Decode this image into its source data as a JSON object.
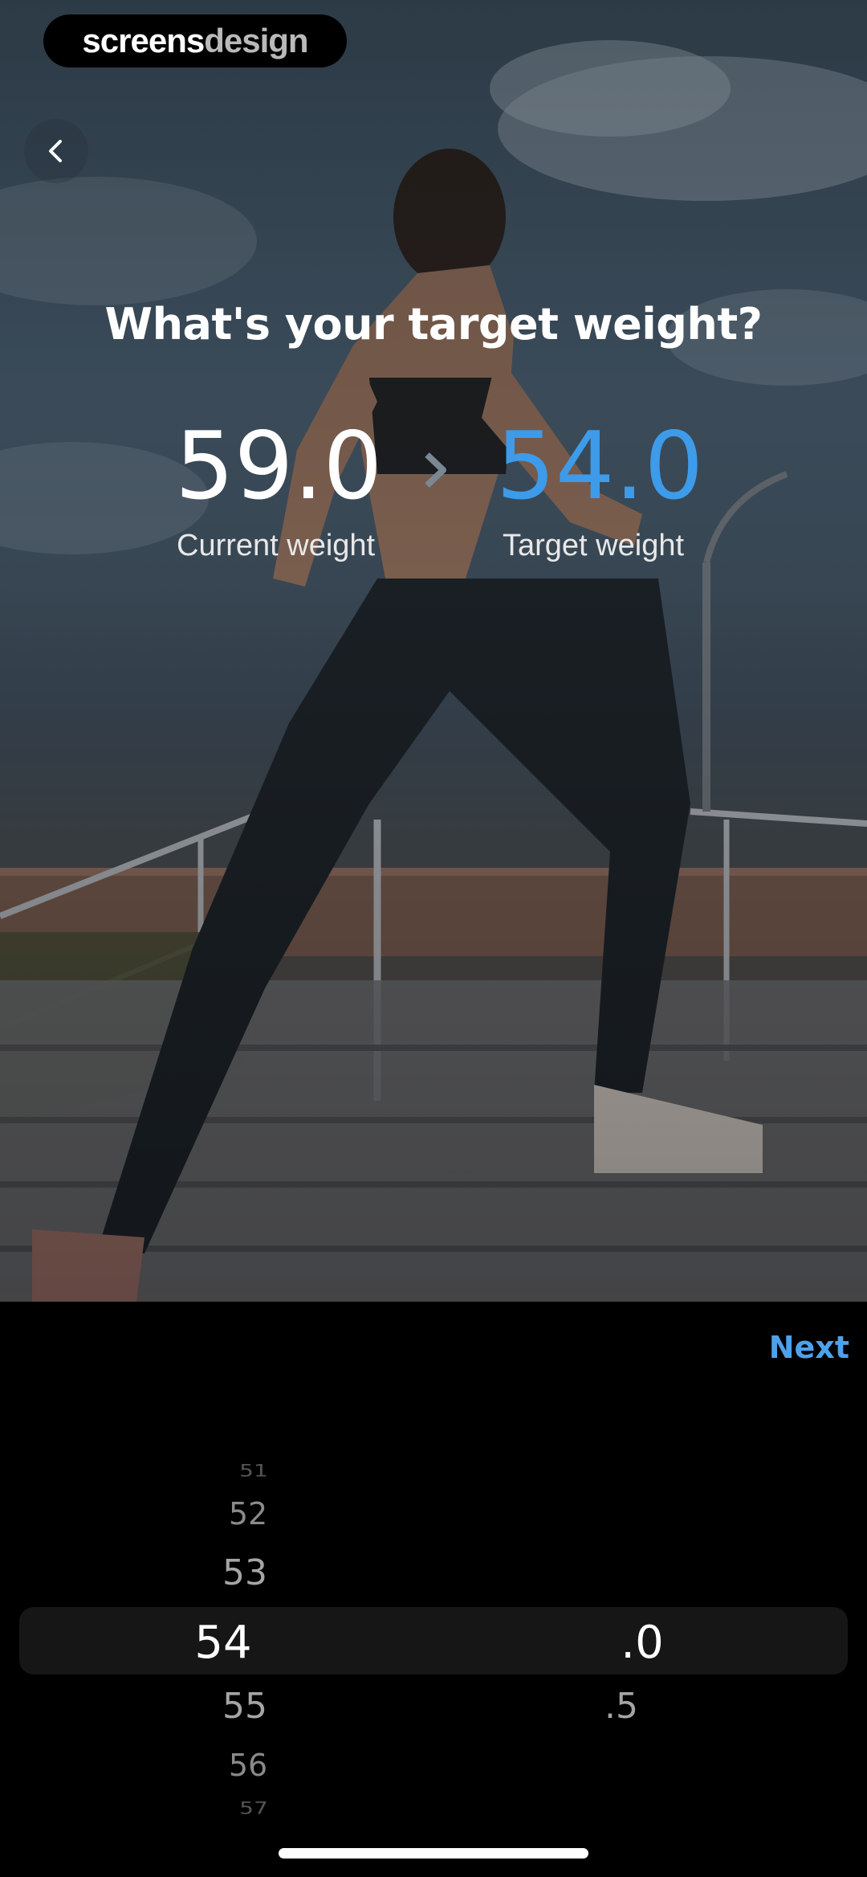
{
  "brand": {
    "part1": "screens",
    "part2": "design"
  },
  "nav": {
    "back_icon": "chevron-left-icon"
  },
  "question": "What's your target weight?",
  "weights": {
    "current_value": "59.0",
    "current_label": "Current weight",
    "arrow_icon": "chevron-right-icon",
    "target_value": "54.0",
    "target_label": "Target weight"
  },
  "next_label": "Next",
  "picker": {
    "integer_column": {
      "items": [
        "51",
        "52",
        "53",
        "54",
        "55",
        "56",
        "57"
      ],
      "selected": "54"
    },
    "decimal_column": {
      "items": [
        ".0",
        ".5"
      ],
      "selected": ".0"
    }
  },
  "colors": {
    "accent": "#3d9be9",
    "next": "#4da1ec",
    "background": "#000000"
  }
}
